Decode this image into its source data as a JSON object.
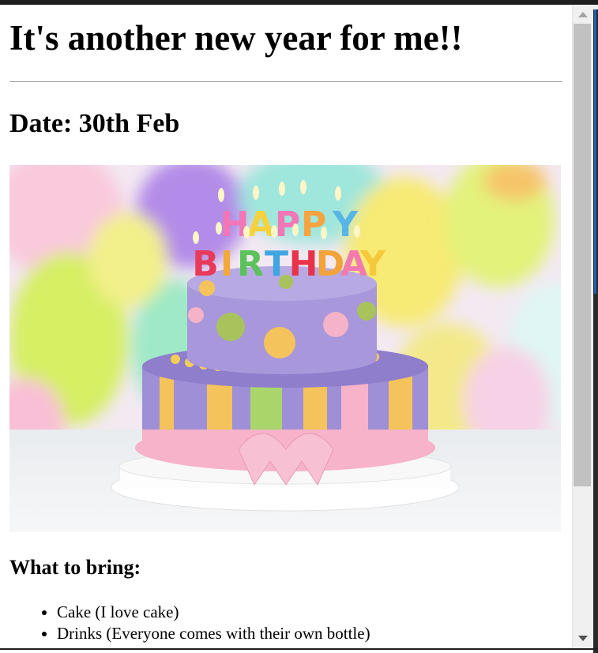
{
  "page": {
    "heading": "It's another new year for me!!",
    "date": "Date: 30th Feb",
    "bring_heading": "What to bring:",
    "items": [
      "Cake (I love cake)",
      "Drinks (Everyone comes with their own bottle)"
    ]
  },
  "image": {
    "candle_row1": [
      "H",
      "A",
      "P",
      "P",
      "Y"
    ],
    "candle_row2": [
      "B",
      "I",
      "R",
      "T",
      "H",
      "D",
      "A",
      "Y"
    ]
  },
  "colors": {
    "background": "#ffffff",
    "scrollbar_thumb": "#c1c1c1",
    "cake_purple": "#9f8fd6",
    "cake_pink": "#f6b3c9"
  }
}
